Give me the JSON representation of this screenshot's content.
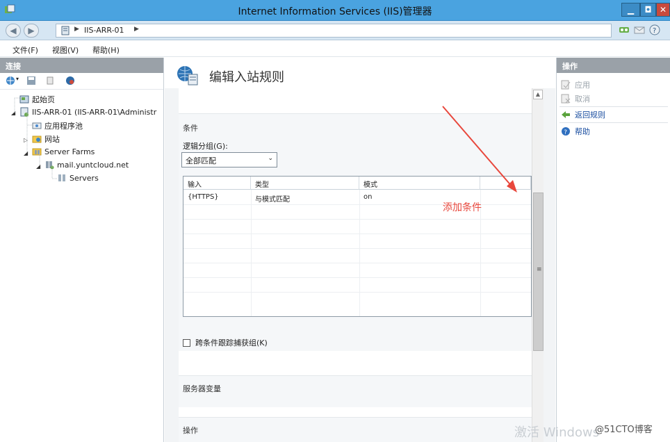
{
  "window": {
    "title": "Internet Information Services (IIS)管理器"
  },
  "address": {
    "crumb": "IIS-ARR-01"
  },
  "menu": {
    "items": [
      "文件(F)",
      "视图(V)",
      "帮助(H)"
    ]
  },
  "connections": {
    "header": "连接",
    "tree": [
      "起始页",
      "IIS-ARR-01 (IIS-ARR-01\\Administr",
      "应用程序池",
      "网站",
      "Server Farms",
      "mail.yuntcloud.net",
      "Servers"
    ]
  },
  "main": {
    "title": "编辑入站规则",
    "conditions": {
      "section_title": "条件",
      "logical_grouping_label": "逻辑分组(G):",
      "logical_grouping_value": "全部匹配",
      "columns": [
        "输入",
        "类型",
        "模式"
      ],
      "rows": [
        [
          "{HTTPS}",
          "与模式匹配",
          "on"
        ]
      ],
      "track_groups_label": "跨条件跟踪捕获组(K)"
    },
    "server_vars_title": "服务器变量",
    "action_title": "操作"
  },
  "actions": {
    "header": "操作",
    "items": [
      {
        "label": "应用",
        "icon": "apply-icon",
        "enabled": false
      },
      {
        "label": "取消",
        "icon": "cancel-icon",
        "enabled": false
      },
      {
        "label": "返回规则",
        "icon": "back-arrow-icon",
        "enabled": true
      },
      {
        "label": "帮助",
        "icon": "help-icon",
        "enabled": true
      }
    ]
  },
  "annotation": {
    "text": "添加条件",
    "color": "#e8473c"
  },
  "watermarks": {
    "windows": "激活 Windows",
    "site": "@51CTO博客"
  }
}
